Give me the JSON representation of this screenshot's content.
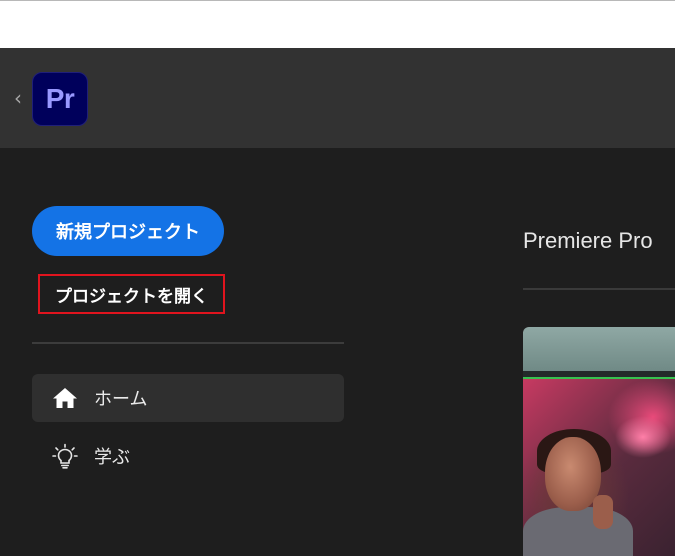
{
  "header": {
    "back_glyph": "‹",
    "app_logo_text": "Pr",
    "app_logo_color": "#00005b",
    "app_logo_text_color": "#9999ff"
  },
  "sidebar": {
    "new_project_label": "新規プロジェクト",
    "open_project_label": "プロジェクトを開く",
    "nav_items": [
      {
        "label": "ホーム",
        "icon": "home-icon",
        "active": true
      },
      {
        "label": "学ぶ",
        "icon": "lightbulb-icon",
        "active": false
      }
    ]
  },
  "main": {
    "section_title": "Premiere Pro"
  },
  "colors": {
    "accent_blue": "#1473e6",
    "highlight_red": "#e0141e",
    "background": "#1e1e1e",
    "header_bg": "#323232"
  }
}
